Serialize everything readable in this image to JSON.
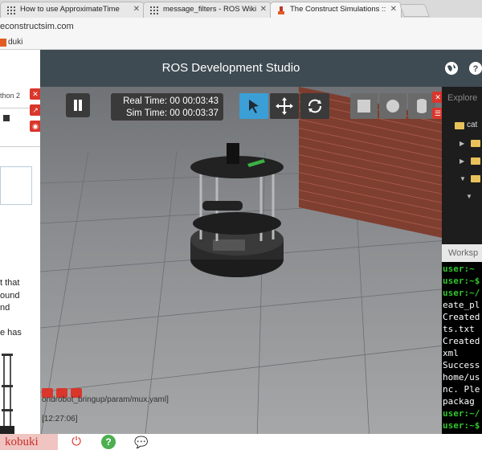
{
  "browser": {
    "tabs": [
      {
        "label": "How to use ApproximateTime"
      },
      {
        "label": "message_filters - ROS Wiki"
      },
      {
        "label": "The Construct Simulations ::"
      }
    ],
    "url": "econstructsim.com",
    "bookmark": "duki"
  },
  "left_panel": {
    "language": "thon 2",
    "text_lines": [
      "t that",
      "ound",
      "nd",
      "e has"
    ]
  },
  "app": {
    "title": "ROS Development Studio"
  },
  "sim": {
    "real_time": "Real Time: 00 00:03:43",
    "sim_time": "Sim Time: 00 00:03:37",
    "log_line": "ondrobot_bringup/param/mux.yaml]",
    "log_time": "[12:27:06]"
  },
  "explorer": {
    "title": "Explore",
    "root_folder": "cat"
  },
  "workspace": {
    "title": "Worksp"
  },
  "terminal": {
    "lines": [
      {
        "text": "user:~",
        "green": true
      },
      {
        "text": "user:~$",
        "green": true
      },
      {
        "text": "user:~/",
        "green": true
      },
      {
        "text": "eate_pl",
        "green": false
      },
      {
        "text": "Created",
        "green": false
      },
      {
        "text": "ts.txt",
        "green": false
      },
      {
        "text": "Created",
        "green": false
      },
      {
        "text": "xml",
        "green": false
      },
      {
        "text": "Success",
        "green": false
      },
      {
        "text": "home/us",
        "green": false
      },
      {
        "text": "nc. Ple",
        "green": false
      },
      {
        "text": " packag",
        "green": false
      },
      {
        "text": "user:~/",
        "green": true
      },
      {
        "text": "user:~$",
        "green": true
      }
    ]
  },
  "bottom": {
    "robot_name": "kobuki"
  },
  "colors": {
    "header_bg": "#3e4b52",
    "accent_blue": "#3b9fd6",
    "danger_red": "#d9362c",
    "terminal_green": "#31c42d"
  }
}
